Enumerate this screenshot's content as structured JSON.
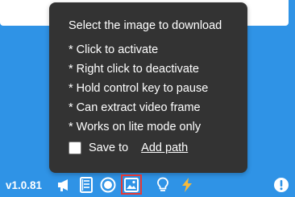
{
  "tooltip": {
    "title": "Select the image to download",
    "lines": [
      "* Click to activate",
      "* Right click to deactivate",
      "* Hold control key to pause",
      "* Can extract video frame",
      "* Works on lite mode only"
    ],
    "save_label": "Save to",
    "add_path_label": "Add path"
  },
  "toolbar": {
    "version": "v1.0.81",
    "icons": [
      "megaphone-icon",
      "document-icon",
      "record-icon",
      "image-icon",
      "lightbulb-icon",
      "lightning-icon",
      "alert-icon"
    ],
    "selected_icon": "image-icon"
  },
  "colors": {
    "background": "#2f93e6",
    "tooltip_bg": "#333333",
    "selected_border": "#e53935",
    "lightning": "#f6b93b"
  }
}
